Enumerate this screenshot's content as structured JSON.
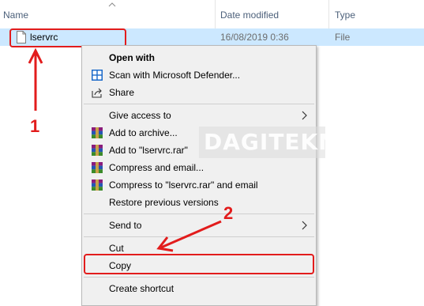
{
  "columns": {
    "name": "Name",
    "date_modified": "Date modified",
    "type": "Type"
  },
  "file": {
    "name": "lservrc",
    "date": "16/08/2019 0:36",
    "type": "File"
  },
  "menu": {
    "open_with": "Open with",
    "scan": "Scan with Microsoft Defender...",
    "share": "Share",
    "give_access": "Give access to",
    "add_archive": "Add to archive...",
    "add_rar": "Add to \"lservrc.rar\"",
    "compress_email": "Compress and email...",
    "compress_rar_email": "Compress to \"lservrc.rar\" and email",
    "restore": "Restore previous versions",
    "send_to": "Send to",
    "cut": "Cut",
    "copy": "Copy",
    "create_shortcut": "Create shortcut"
  },
  "annotations": {
    "step1": "1",
    "step2": "2"
  },
  "watermark": "DAGITEKNO",
  "icons": {
    "file": "file-icon",
    "defender": "defender-shield-icon",
    "share": "share-icon",
    "winrar": "winrar-icon",
    "chevron": "chevron-right-icon",
    "sort": "sort-caret-icon"
  },
  "colors": {
    "selection": "#cce8ff",
    "highlight": "#e21c1c",
    "menu_bg": "#f0f0f0",
    "header_text": "#4c607a"
  }
}
